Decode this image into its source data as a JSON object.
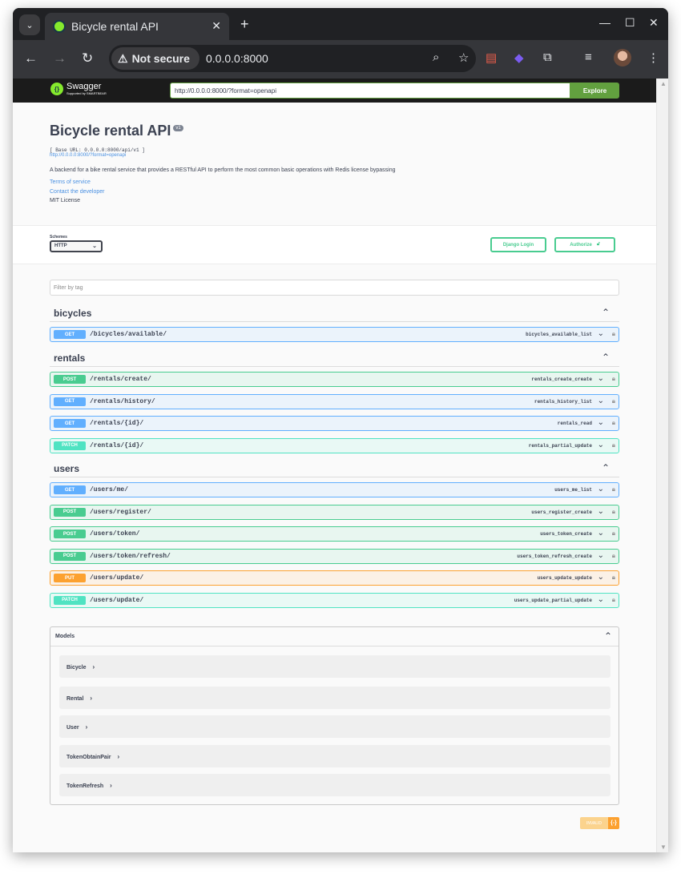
{
  "browser": {
    "tab_title": "Bicycle rental API",
    "security_label": "Not secure",
    "url": "0.0.0.0:8000"
  },
  "swagger": {
    "logo_text": "Swagger",
    "logo_subtext": "Supported by SMARTBEAR",
    "spec_url": "http://0.0.0.0:8000/?format=openapi",
    "explore_label": "Explore",
    "title": "Bicycle rental API",
    "version": "v1",
    "base_url": "[ Base URL: 0.0.0.0:8000/api/v1 ]",
    "spec_link": "http://0.0.0.0:8000/?format=openapi",
    "description": "A backend for a bike rental service that provides a RESTful API to perform the most common basic operations with Redis license bypassing",
    "terms_link": "Terms of service",
    "contact_link": "Contact the developer",
    "license": "MIT License",
    "schemes_label": "Schemes",
    "scheme_selected": "HTTP",
    "django_login_label": "Django Login",
    "authorize_label": "Authorize",
    "filter_placeholder": "Filter by tag",
    "tags": [
      {
        "name": "bicycles",
        "operations": [
          {
            "method": "GET",
            "path": "/bicycles/available/",
            "id": "bicycles_available_list"
          }
        ]
      },
      {
        "name": "rentals",
        "operations": [
          {
            "method": "POST",
            "path": "/rentals/create/",
            "id": "rentals_create_create"
          },
          {
            "method": "GET",
            "path": "/rentals/history/",
            "id": "rentals_history_list"
          },
          {
            "method": "GET",
            "path": "/rentals/{id}/",
            "id": "rentals_read"
          },
          {
            "method": "PATCH",
            "path": "/rentals/{id}/",
            "id": "rentals_partial_update"
          }
        ]
      },
      {
        "name": "users",
        "operations": [
          {
            "method": "GET",
            "path": "/users/me/",
            "id": "users_me_list"
          },
          {
            "method": "POST",
            "path": "/users/register/",
            "id": "users_register_create"
          },
          {
            "method": "POST",
            "path": "/users/token/",
            "id": "users_token_create"
          },
          {
            "method": "POST",
            "path": "/users/token/refresh/",
            "id": "users_token_refresh_create"
          },
          {
            "method": "PUT",
            "path": "/users/update/",
            "id": "users_update_update"
          },
          {
            "method": "PATCH",
            "path": "/users/update/",
            "id": "users_update_partial_update"
          }
        ]
      }
    ],
    "models_title": "Models",
    "models": [
      "Bicycle",
      "Rental",
      "User",
      "TokenObtainPair",
      "TokenRefresh"
    ],
    "validator_label": "INVALID",
    "validator_icon": "{-}"
  },
  "colors": {
    "get": "#61affe",
    "post": "#49cc90",
    "patch": "#50e3c2",
    "put": "#fca130",
    "swagger_green": "#62a03f"
  }
}
